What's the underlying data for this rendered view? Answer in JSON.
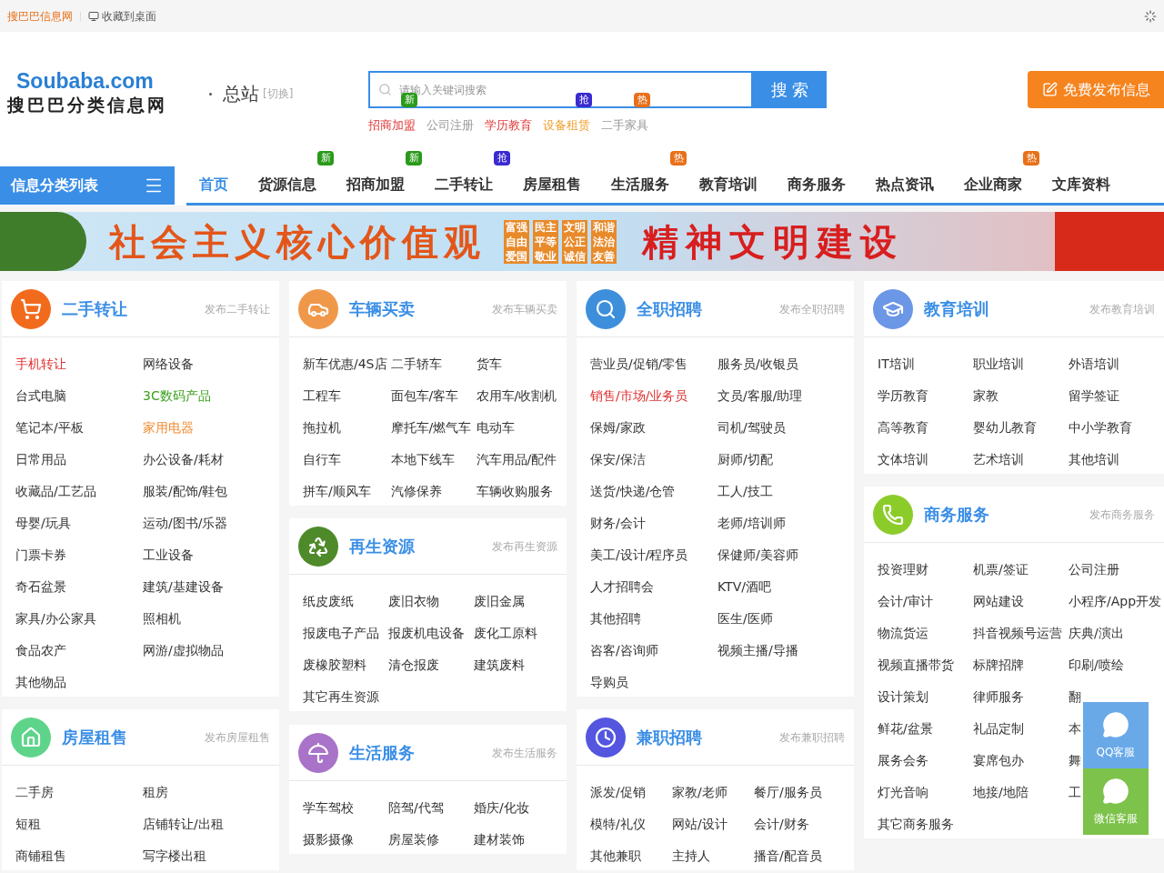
{
  "top_bar": {
    "site_link": "搜巴巴信息网",
    "bookmark": "收藏到桌面"
  },
  "header": {
    "logo_latin": "Soubaba.com",
    "logo_cn": "搜巴巴分类信息网",
    "city": "总站",
    "switch": "[切换]",
    "search": {
      "placeholder": "请输入关键词搜索",
      "button": "搜 索"
    },
    "hot_links": [
      {
        "label": "招商加盟",
        "color": "#e03a3a",
        "badge": {
          "text": "新",
          "kind": "new"
        }
      },
      {
        "label": "公司注册",
        "color": "#999999"
      },
      {
        "label": "学历教育",
        "color": "#e03a3a"
      },
      {
        "label": "设备租赁",
        "color": "#f0a030",
        "badge": {
          "text": "抢",
          "kind": "grab"
        }
      },
      {
        "label": "二手家具",
        "color": "#999999",
        "badge": {
          "text": "热",
          "kind": "hot"
        }
      }
    ],
    "publish_button": "免费发布信息"
  },
  "nav": {
    "category_menu": "信息分类列表",
    "items": [
      {
        "label": "首页",
        "selected": true
      },
      {
        "label": "货源信息",
        "selected": false,
        "badge": {
          "text": "新",
          "kind": "new"
        }
      },
      {
        "label": "招商加盟",
        "selected": false,
        "badge": {
          "text": "新",
          "kind": "new"
        }
      },
      {
        "label": "二手转让",
        "selected": false,
        "badge": {
          "text": "抢",
          "kind": "grab"
        }
      },
      {
        "label": "房屋租售",
        "selected": false
      },
      {
        "label": "生活服务",
        "selected": false,
        "badge": {
          "text": "热",
          "kind": "hot"
        }
      },
      {
        "label": "教育培训",
        "selected": false
      },
      {
        "label": "商务服务",
        "selected": false
      },
      {
        "label": "热点资讯",
        "selected": false
      },
      {
        "label": "企业商家",
        "selected": false,
        "badge": {
          "text": "热",
          "kind": "hot"
        }
      },
      {
        "label": "文库资料",
        "selected": false
      }
    ]
  },
  "banner": {
    "slogan": "社会主义核心价值观",
    "values": [
      "富强",
      "民主",
      "文明",
      "和谐",
      "自由",
      "平等",
      "公正",
      "法治",
      "爱国",
      "敬业",
      "诚信",
      "友善"
    ],
    "motto": "精神文明建设"
  },
  "columns": [
    [
      {
        "title": "二手转让",
        "kind": "secondhand",
        "publish_link": "发布二手转让",
        "items": [
          {
            "label": "手机转让",
            "color": "#e03030"
          },
          {
            "label": "网络设备"
          },
          {
            "label": "台式电脑"
          },
          {
            "label": "3C数码产品",
            "color": "#3aa01a"
          },
          {
            "label": "笔记本/平板"
          },
          {
            "label": "家用电器",
            "color": "#f08a30"
          },
          {
            "label": "日常用品"
          },
          {
            "label": "办公设备/耗材"
          },
          {
            "label": "收藏品/工艺品"
          },
          {
            "label": "服装/配饰/鞋包"
          },
          {
            "label": "母婴/玩具"
          },
          {
            "label": "运动/图书/乐器"
          },
          {
            "label": "门票卡券"
          },
          {
            "label": "工业设备"
          },
          {
            "label": "奇石盆景"
          },
          {
            "label": "建筑/基建设备"
          },
          {
            "label": "家具/办公家具"
          },
          {
            "label": "照相机"
          },
          {
            "label": "食品农产"
          },
          {
            "label": "网游/虚拟物品"
          },
          {
            "label": "其他物品"
          }
        ]
      },
      {
        "title": "房屋租售",
        "kind": "housing",
        "publish_link": "发布房屋租售",
        "items": [
          {
            "label": "二手房"
          },
          {
            "label": "租房"
          },
          {
            "label": "短租"
          },
          {
            "label": "店铺转让/出租"
          },
          {
            "label": "商铺租售"
          },
          {
            "label": "写字楼出租"
          }
        ]
      }
    ],
    [
      {
        "title": "车辆买卖",
        "kind": "vehicles",
        "publish_link": "发布车辆买卖",
        "items": [
          {
            "label": "新车优惠/4S店"
          },
          {
            "label": "二手轿车"
          },
          {
            "label": "货车"
          },
          {
            "label": "工程车"
          },
          {
            "label": "面包车/客车"
          },
          {
            "label": "农用车/收割机"
          },
          {
            "label": "拖拉机"
          },
          {
            "label": "摩托车/燃气车"
          },
          {
            "label": "电动车"
          },
          {
            "label": "自行车"
          },
          {
            "label": "本地下线车"
          },
          {
            "label": "汽车用品/配件"
          },
          {
            "label": "拼车/顺风车"
          },
          {
            "label": "汽修保养"
          },
          {
            "label": "车辆收购服务"
          }
        ]
      },
      {
        "title": "再生资源",
        "kind": "recycling",
        "publish_link": "发布再生资源",
        "items": [
          {
            "label": "纸皮废纸"
          },
          {
            "label": "废旧衣物"
          },
          {
            "label": "废旧金属"
          },
          {
            "label": "报废电子产品"
          },
          {
            "label": "报废机电设备"
          },
          {
            "label": "废化工原料"
          },
          {
            "label": "废橡胶塑料"
          },
          {
            "label": "清仓报废"
          },
          {
            "label": "建筑废料"
          },
          {
            "label": "其它再生资源"
          }
        ]
      },
      {
        "title": "生活服务",
        "kind": "life",
        "publish_link": "发布生活服务",
        "items": [
          {
            "label": "学车驾校"
          },
          {
            "label": "陪驾/代驾"
          },
          {
            "label": "婚庆/化妆"
          },
          {
            "label": "摄影摄像"
          },
          {
            "label": "房屋装修"
          },
          {
            "label": "建材装饰"
          }
        ]
      }
    ],
    [
      {
        "title": "全职招聘",
        "kind": "fulltime",
        "publish_link": "发布全职招聘",
        "items": [
          {
            "label": "营业员/促销/零售"
          },
          {
            "label": "服务员/收银员"
          },
          {
            "label": "销售/市场/业务员",
            "color": "#e03030"
          },
          {
            "label": "文员/客服/助理"
          },
          {
            "label": "保姆/家政"
          },
          {
            "label": "司机/驾驶员"
          },
          {
            "label": "保安/保洁"
          },
          {
            "label": "厨师/切配"
          },
          {
            "label": "送货/快递/仓管"
          },
          {
            "label": "工人/技工"
          },
          {
            "label": "财务/会计"
          },
          {
            "label": "老师/培训师"
          },
          {
            "label": "美工/设计/程序员"
          },
          {
            "label": "保健师/美容师"
          },
          {
            "label": "人才招聘会"
          },
          {
            "label": "KTV/酒吧"
          },
          {
            "label": "其他招聘"
          },
          {
            "label": "医生/医师"
          },
          {
            "label": "咨客/咨询师"
          },
          {
            "label": "视频主播/导播"
          },
          {
            "label": "导购员"
          }
        ]
      },
      {
        "title": "兼职招聘",
        "kind": "parttime",
        "publish_link": "发布兼职招聘",
        "items": [
          {
            "label": "派发/促销"
          },
          {
            "label": "家教/老师"
          },
          {
            "label": "餐厅/服务员"
          },
          {
            "label": "模特/礼仪"
          },
          {
            "label": "网站/设计"
          },
          {
            "label": "会计/财务"
          },
          {
            "label": "其他兼职"
          },
          {
            "label": "主持人"
          },
          {
            "label": "播音/配音员"
          }
        ]
      }
    ],
    [
      {
        "title": "教育培训",
        "kind": "education",
        "publish_link": "发布教育培训",
        "items": [
          {
            "label": "IT培训"
          },
          {
            "label": "职业培训"
          },
          {
            "label": "外语培训"
          },
          {
            "label": "学历教育"
          },
          {
            "label": "家教"
          },
          {
            "label": "留学签证"
          },
          {
            "label": "高等教育"
          },
          {
            "label": "婴幼儿教育"
          },
          {
            "label": "中小学教育"
          },
          {
            "label": "文体培训"
          },
          {
            "label": "艺术培训"
          },
          {
            "label": "其他培训"
          }
        ]
      },
      {
        "title": "商务服务",
        "kind": "business",
        "publish_link": "发布商务服务",
        "items": [
          {
            "label": "投资理财"
          },
          {
            "label": "机票/签证"
          },
          {
            "label": "公司注册"
          },
          {
            "label": "会计/审计"
          },
          {
            "label": "网站建设"
          },
          {
            "label": "小程序/App开发"
          },
          {
            "label": "物流货运"
          },
          {
            "label": "抖音视频号运营"
          },
          {
            "label": "庆典/演出"
          },
          {
            "label": "视频直播带货"
          },
          {
            "label": "标牌招牌"
          },
          {
            "label": "印刷/喷绘"
          },
          {
            "label": "设计策划"
          },
          {
            "label": "律师服务"
          },
          {
            "label": "翻"
          },
          {
            "label": "鲜花/盆景"
          },
          {
            "label": "礼品定制"
          },
          {
            "label": "本"
          },
          {
            "label": "展务会务"
          },
          {
            "label": "宴席包办"
          },
          {
            "label": "舞"
          },
          {
            "label": "灯光音响"
          },
          {
            "label": "地接/地陪"
          },
          {
            "label": "工"
          },
          {
            "label": "其它商务服务"
          }
        ]
      }
    ]
  ],
  "float_service": [
    {
      "label": "QQ客服",
      "kind": "qq"
    },
    {
      "label": "微信客服",
      "kind": "wechat"
    }
  ]
}
